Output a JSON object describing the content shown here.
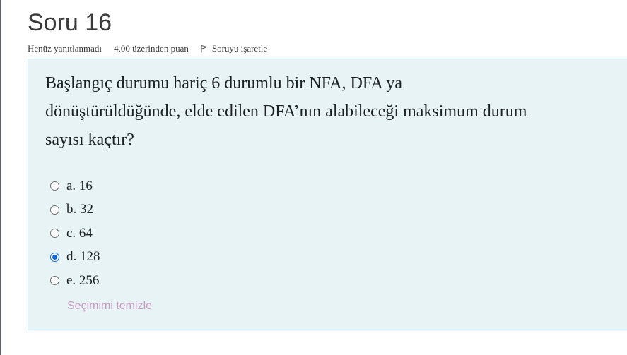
{
  "question": {
    "title": "Soru 16",
    "state": "Henüz yanıtlanmadı",
    "grade": "4.00 üzerinden puan",
    "flag_label": "Soruyu işaretle",
    "flag_icon": "flag-icon",
    "text_lines": [
      "Başlangıç durumu hariç 6 durumlu bir NFA, DFA ya",
      "dönüştürüldüğünde, elde edilen DFA’nın alabileceği maksimum durum",
      "sayısı kaçtır?"
    ],
    "answers": [
      {
        "label": "a. 16",
        "selected": false
      },
      {
        "label": "b. 32",
        "selected": false
      },
      {
        "label": "c. 64",
        "selected": false
      },
      {
        "label": "d. 128",
        "selected": true
      },
      {
        "label": "e. 256",
        "selected": false
      }
    ],
    "clear_label": "Seçimimi temizle"
  },
  "colors": {
    "content_background": "#e7f3f5",
    "content_border": "#b8dce2",
    "radio_selected": "#0a66d4",
    "clear_link": "#c89ac2"
  }
}
